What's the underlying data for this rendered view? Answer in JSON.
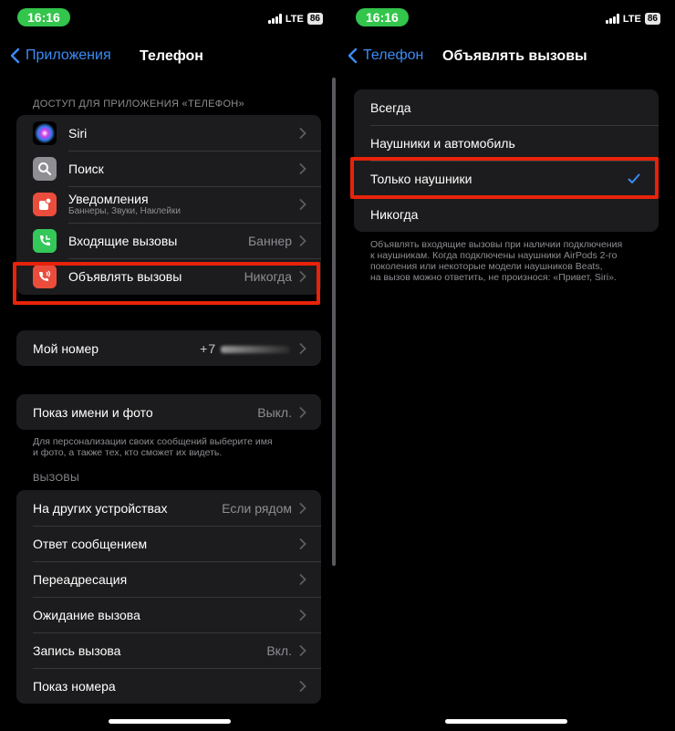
{
  "status_bar": {
    "time": "16:16",
    "network": "LTE",
    "battery": "86"
  },
  "left": {
    "nav": {
      "back_label": "Приложения",
      "title": "Телефон"
    },
    "access_header": "ДОСТУП ДЛЯ ПРИЛОЖЕНИЯ «ТЕЛЕФОН»",
    "access_items": [
      {
        "label": "Siri",
        "subtitle": "",
        "value": ""
      },
      {
        "label": "Поиск",
        "subtitle": "",
        "value": ""
      },
      {
        "label": "Уведомления",
        "subtitle": "Баннеры, Звуки, Наклейки",
        "value": ""
      },
      {
        "label": "Входящие вызовы",
        "subtitle": "",
        "value": "Баннер"
      },
      {
        "label": "Объявлять вызовы",
        "subtitle": "",
        "value": "Никогда"
      }
    ],
    "my_number": {
      "label": "Мой номер",
      "value": "+7"
    },
    "name_photo": {
      "label": "Показ имени и фото",
      "value": "Выкл."
    },
    "name_photo_footnote_lines": [
      "Для персонализации своих сообщений выберите имя",
      "и фото, а также тех, кто сможет их видеть."
    ],
    "calls_header": "ВЫЗОВЫ",
    "calls_items": [
      {
        "label": "На других устройствах",
        "value": "Если рядом"
      },
      {
        "label": "Ответ сообщением",
        "value": ""
      },
      {
        "label": "Переадресация",
        "value": ""
      },
      {
        "label": "Ожидание вызова",
        "value": ""
      },
      {
        "label": "Запись вызова",
        "value": "Вкл."
      },
      {
        "label": "Показ номера",
        "value": ""
      }
    ]
  },
  "right": {
    "nav": {
      "back_label": "Телефон",
      "title": "Объявлять вызовы"
    },
    "options": [
      {
        "label": "Всегда",
        "selected": false
      },
      {
        "label": "Наушники и автомобиль",
        "selected": false
      },
      {
        "label": "Только наушники",
        "selected": true
      },
      {
        "label": "Никогда",
        "selected": false
      }
    ],
    "footnote_lines": [
      "Объявлять входящие вызовы при наличии подключения",
      "к наушникам. Когда подключены наушники AirPods 2-го",
      "поколения или некоторые модели наушников Beats,",
      "на вызов можно ответить, не произнося: «Привет, Siri»."
    ]
  },
  "colors": {
    "accent": "#3b8cf5",
    "highlight": "#e8220b",
    "cell_bg": "#1c1c1e",
    "status_time_bg": "#33c54c"
  },
  "icons": [
    "siri-icon",
    "search-icon",
    "notifications-icon",
    "incoming-calls-icon",
    "announce-calls-icon",
    "chevron-left-icon",
    "chevron-right-icon",
    "checkmark-icon"
  ]
}
